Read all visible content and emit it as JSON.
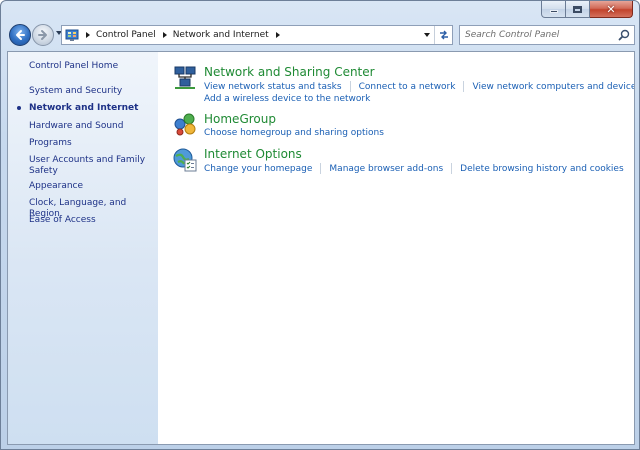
{
  "window": {
    "caption_buttons": [
      "minimize-icon",
      "maximize-icon",
      "close-icon"
    ]
  },
  "toolbar": {
    "breadcrumbs": [
      "Control Panel",
      "Network and Internet"
    ],
    "search_placeholder": "Search Control Panel"
  },
  "sidebar": {
    "items": [
      {
        "label": "Control Panel Home",
        "current": false
      },
      {
        "label": "System and Security",
        "current": false
      },
      {
        "label": "Network and Internet",
        "current": true
      },
      {
        "label": "Hardware and Sound",
        "current": false
      },
      {
        "label": "Programs",
        "current": false
      },
      {
        "label": "User Accounts and Family Safety",
        "current": false
      },
      {
        "label": "Appearance",
        "current": false
      },
      {
        "label": "Clock, Language, and Region",
        "current": false
      },
      {
        "label": "Ease of Access",
        "current": false
      }
    ]
  },
  "categories": [
    {
      "title": "Network and Sharing Center",
      "icon": "network-sharing-center-icon",
      "tasks": [
        "View network status and tasks",
        "Connect to a network",
        "View network computers and devices",
        "Add a wireless device to the network"
      ]
    },
    {
      "title": "HomeGroup",
      "icon": "homegroup-icon",
      "tasks": [
        "Choose homegroup and sharing options"
      ]
    },
    {
      "title": "Internet Options",
      "icon": "internet-options-icon",
      "tasks": [
        "Change your homepage",
        "Manage browser add-ons",
        "Delete browsing history and cookies"
      ]
    }
  ],
  "colors": {
    "title_green": "#1f8a34",
    "link_blue": "#1a5fb4",
    "sidebar_blue": "#1e3287"
  }
}
